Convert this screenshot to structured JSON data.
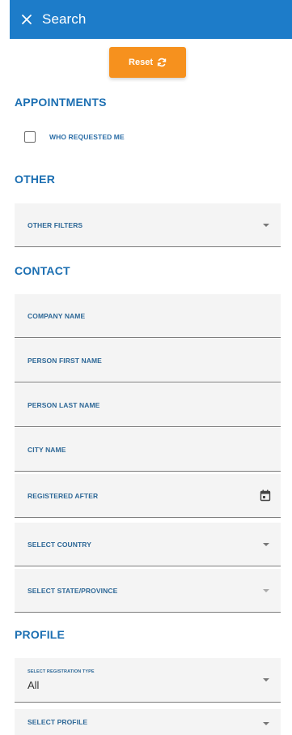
{
  "header": {
    "title": "Search",
    "color": "#1d7cc9"
  },
  "reset": {
    "label": "Reset",
    "color": "#f6911e",
    "icon": "refresh-icon"
  },
  "sections": {
    "appointments": {
      "title": "APPOINTMENTS",
      "checkbox_label": "WHO REQUESTED ME"
    },
    "other": {
      "title": "OTHER",
      "other_filters": "OTHER FILTERS"
    },
    "contact": {
      "title": "CONTACT",
      "company_name": "COMPANY NAME",
      "person_first_name": "PERSON FIRST NAME",
      "person_last_name": "PERSON LAST NAME",
      "city_name": "CITY NAME",
      "registered_after": "REGISTERED AFTER",
      "select_country": "SELECT COUNTRY",
      "select_state": "SELECT STATE/PROVINCE"
    },
    "profile": {
      "title": "PROFILE",
      "registration_type_label": "SELECT REGISTRATION TYPE",
      "registration_type_value": "All",
      "select_profile": "SELECT PROFILE"
    }
  },
  "icons": {
    "close": "close-icon",
    "calendar": "calendar-icon",
    "dropdown": "chevron-down-icon"
  }
}
